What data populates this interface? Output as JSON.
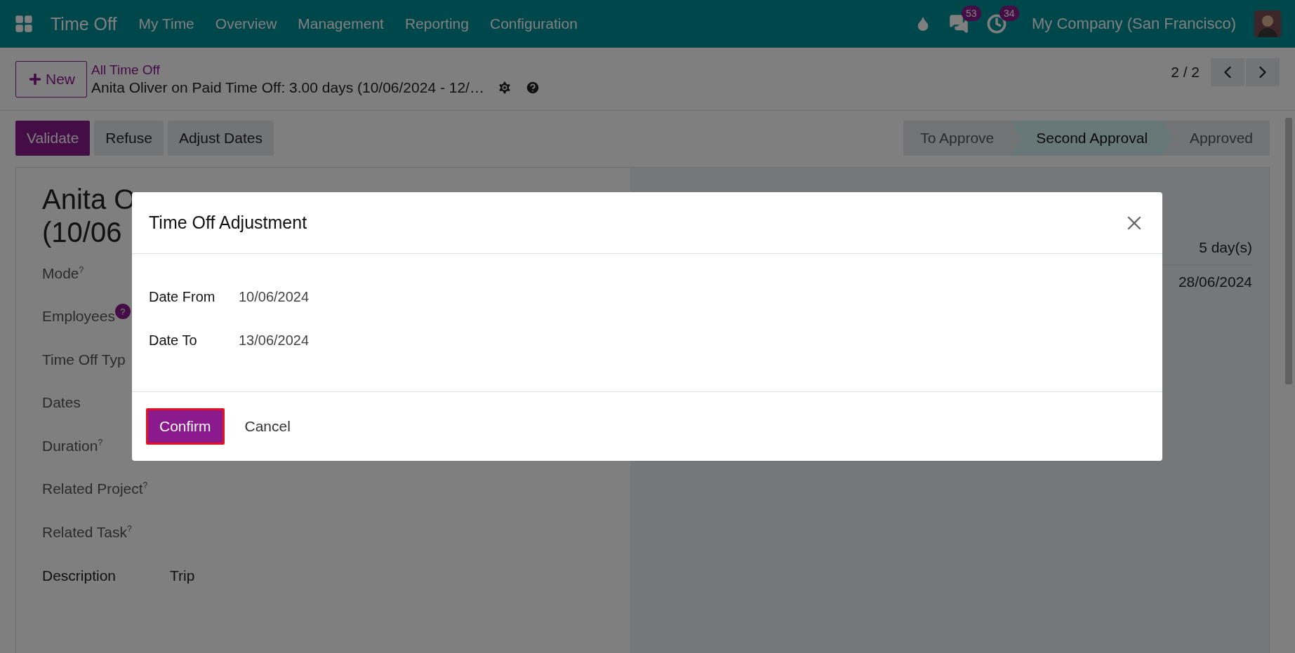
{
  "navbar": {
    "app_name": "Time Off",
    "menu": [
      "My Time",
      "Overview",
      "Management",
      "Reporting",
      "Configuration"
    ],
    "message_count": "53",
    "activity_count": "34",
    "company": "My Company (San Francisco)"
  },
  "control_panel": {
    "new_button": "New",
    "breadcrumb": "All Time Off",
    "record_title": "Anita Oliver on Paid Time Off: 3.00 days (10/06/2024 - 12/…",
    "pager": "2 / 2"
  },
  "actions": [
    {
      "label": "Validate",
      "kind": "primary"
    },
    {
      "label": "Refuse",
      "kind": "secondary"
    },
    {
      "label": "Adjust Dates",
      "kind": "secondary"
    }
  ],
  "stages": [
    {
      "label": "To Approve",
      "selected": false
    },
    {
      "label": "Second Approval",
      "selected": true
    },
    {
      "label": "Approved",
      "selected": false
    }
  ],
  "form": {
    "title_lines": [
      "Anita O",
      "(10/06"
    ],
    "fields": [
      {
        "label": "Mode$^{?}$"
      },
      {
        "label": "Employees",
        "help_badge": "?"
      },
      {
        "label": "Time Off Typ"
      },
      {
        "label": "Dates"
      },
      {
        "label": "Duration$^{?}$"
      },
      {
        "label": "Related Project$^{?}$"
      },
      {
        "label": "Related Task$^{?}$"
      }
    ],
    "description": {
      "label": "Description",
      "value": "Trip"
    },
    "side_values": [
      "5 day(s)",
      "28/06/2024"
    ]
  },
  "dialog": {
    "title": "Time Off Adjustment",
    "fields": [
      {
        "label": "Date From",
        "value": "10/06/2024"
      },
      {
        "label": "Date To",
        "value": "13/06/2024"
      }
    ],
    "buttons": [
      {
        "label": "Confirm",
        "kind": "primary",
        "focused": true
      },
      {
        "label": "Cancel",
        "kind": "link",
        "focused": false
      }
    ]
  }
}
